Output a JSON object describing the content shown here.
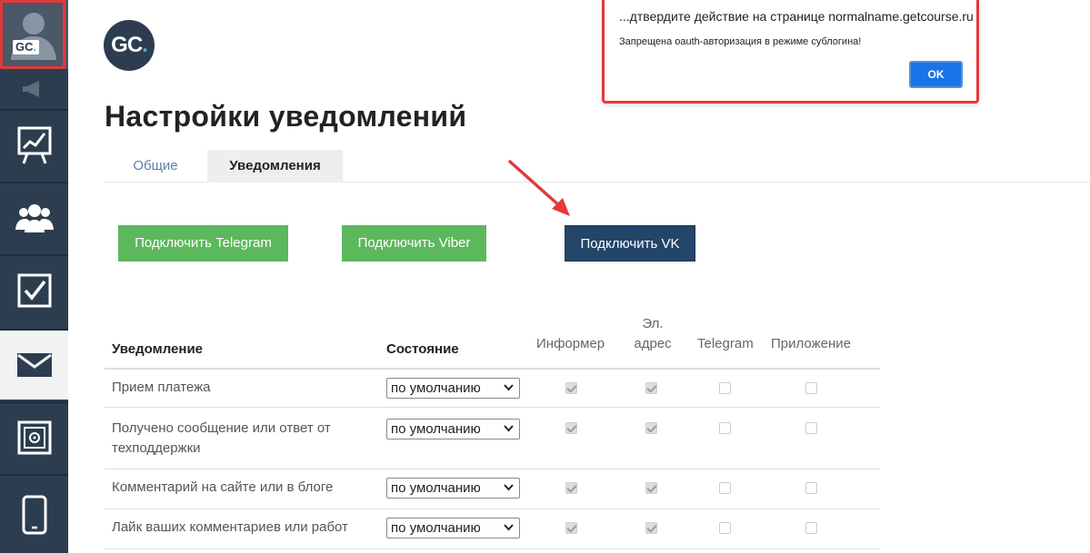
{
  "sidebar": {
    "avatar_badge": "GC",
    "avatar_badge_dot": ".",
    "items": [
      {
        "icon": "chart-board-icon"
      },
      {
        "icon": "users-icon"
      },
      {
        "icon": "checkbox-icon"
      },
      {
        "icon": "envelope-icon",
        "active": true
      },
      {
        "icon": "safe-icon"
      },
      {
        "icon": "smartphone-icon"
      }
    ]
  },
  "logo": {
    "text": "GC",
    "dot": "."
  },
  "page": {
    "title": "Настройки уведомлений"
  },
  "tabs": [
    {
      "label": "Общие",
      "active": false
    },
    {
      "label": "Уведомления",
      "active": true
    }
  ],
  "buttons": {
    "telegram": "Подключить Telegram",
    "viber": "Подключить Viber",
    "vk": "Подключить VK"
  },
  "table": {
    "headers": {
      "notification": "Уведомление",
      "state": "Состояние",
      "informer": "Информер",
      "email_line1": "Эл.",
      "email_line2": "адрес",
      "telegram": "Telegram",
      "app": "Приложение"
    },
    "rows": [
      {
        "label": "Прием платежа",
        "state": "по умолчанию",
        "informer": true,
        "email": true,
        "telegram": false,
        "app": false
      },
      {
        "label": "Получено сообщение или ответ от техподдержки",
        "state": "по умолчанию",
        "informer": true,
        "email": true,
        "telegram": false,
        "app": false
      },
      {
        "label": "Комментарий на сайте или в блоге",
        "state": "по умолчанию",
        "informer": true,
        "email": true,
        "telegram": false,
        "app": false
      },
      {
        "label": "Лайк ваших комментариев или работ",
        "state": "по умолчанию",
        "informer": true,
        "email": true,
        "telegram": false,
        "app": false
      }
    ]
  },
  "dialog": {
    "title": "...дтвердите действие на странице normalname.getcourse.ru",
    "message": "Запрещена oauth-авторизация в режиме сублогина!",
    "ok_label": "OK"
  },
  "colors": {
    "sidebar": "#2c3d50",
    "green_button": "#5cb85c",
    "vk_button": "#24456a",
    "highlight": "#e3393b",
    "dialog_ok": "#1a73e8"
  }
}
